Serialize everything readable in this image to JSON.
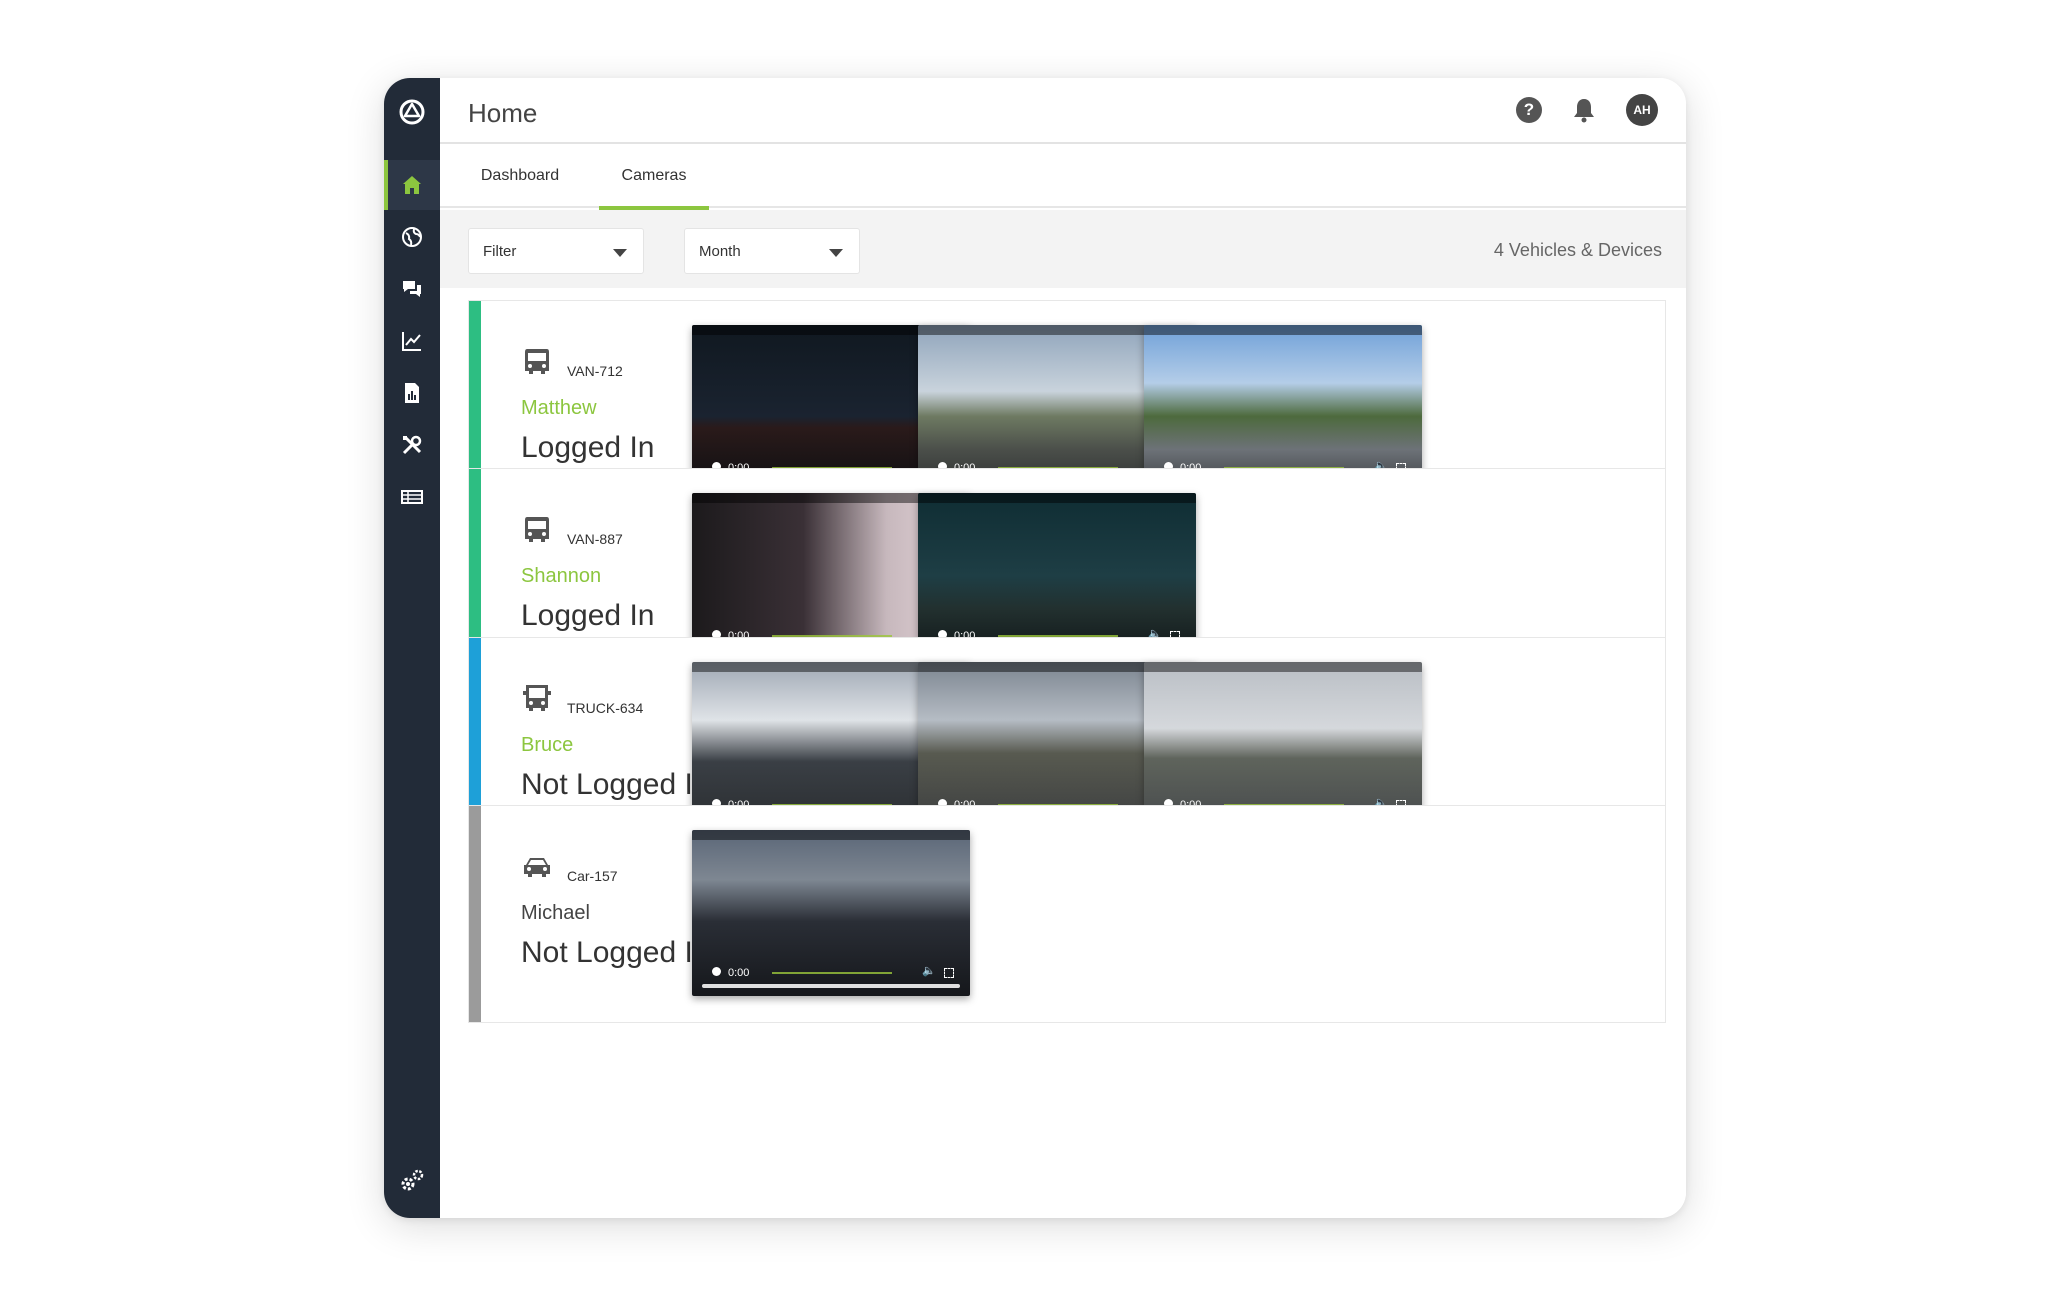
{
  "app": {
    "page_title": "Home",
    "avatar_initials": "AH",
    "help_glyph": "?",
    "accent_color": "#8cc63f"
  },
  "sidebar": {
    "items": [
      {
        "icon": "home-icon",
        "active": true
      },
      {
        "icon": "globe-icon",
        "active": false
      },
      {
        "icon": "messages-icon",
        "active": false
      },
      {
        "icon": "trend-chart-icon",
        "active": false
      },
      {
        "icon": "report-icon",
        "active": false
      },
      {
        "icon": "tools-icon",
        "active": false
      },
      {
        "icon": "list-icon",
        "active": false
      }
    ],
    "bottom_icon": "settings-icon"
  },
  "tabs": [
    {
      "label": "Dashboard",
      "active": false
    },
    {
      "label": "Cameras",
      "active": true
    }
  ],
  "toolbar": {
    "filter_label": "Filter",
    "period_label": "Month",
    "count_text": "4 Vehicles & Devices"
  },
  "vehicles": [
    {
      "id": "VAN-712",
      "type": "van-icon",
      "driver": "Matthew",
      "status": "Logged In",
      "stripe_color": "#2dbe82",
      "driver_color": "#8cc63f",
      "videos": [
        {
          "time": "0:00",
          "scene": "night-traffic"
        },
        {
          "time": "0:00",
          "scene": "intersection-day"
        },
        {
          "time": "0:00",
          "scene": "highway-mirror"
        }
      ]
    },
    {
      "id": "VAN-887",
      "type": "van-icon",
      "driver": "Shannon",
      "status": "Logged In",
      "stripe_color": "#2dbe82",
      "driver_color": "#8cc63f",
      "videos": [
        {
          "time": "0:00",
          "scene": "cabin-view"
        },
        {
          "time": "0:00",
          "scene": "night-street"
        }
      ]
    },
    {
      "id": "TRUCK-634",
      "type": "truck-icon",
      "driver": "Bruce",
      "status": "Not Logged In",
      "stripe_color": "#1ea0d8",
      "driver_color": "#8cc63f",
      "videos": [
        {
          "time": "0:00",
          "scene": "palm-road"
        },
        {
          "time": "0:00",
          "scene": "freeway-van"
        },
        {
          "time": "0:00",
          "scene": "freeway-wide"
        }
      ]
    },
    {
      "id": "Car-157",
      "type": "car-icon",
      "driver": "Michael",
      "status": "Not Logged In",
      "stripe_color": "#9b9b9b",
      "driver_color": "#444444",
      "videos": [
        {
          "time": "0:00",
          "scene": "dusk-truck"
        }
      ]
    }
  ]
}
